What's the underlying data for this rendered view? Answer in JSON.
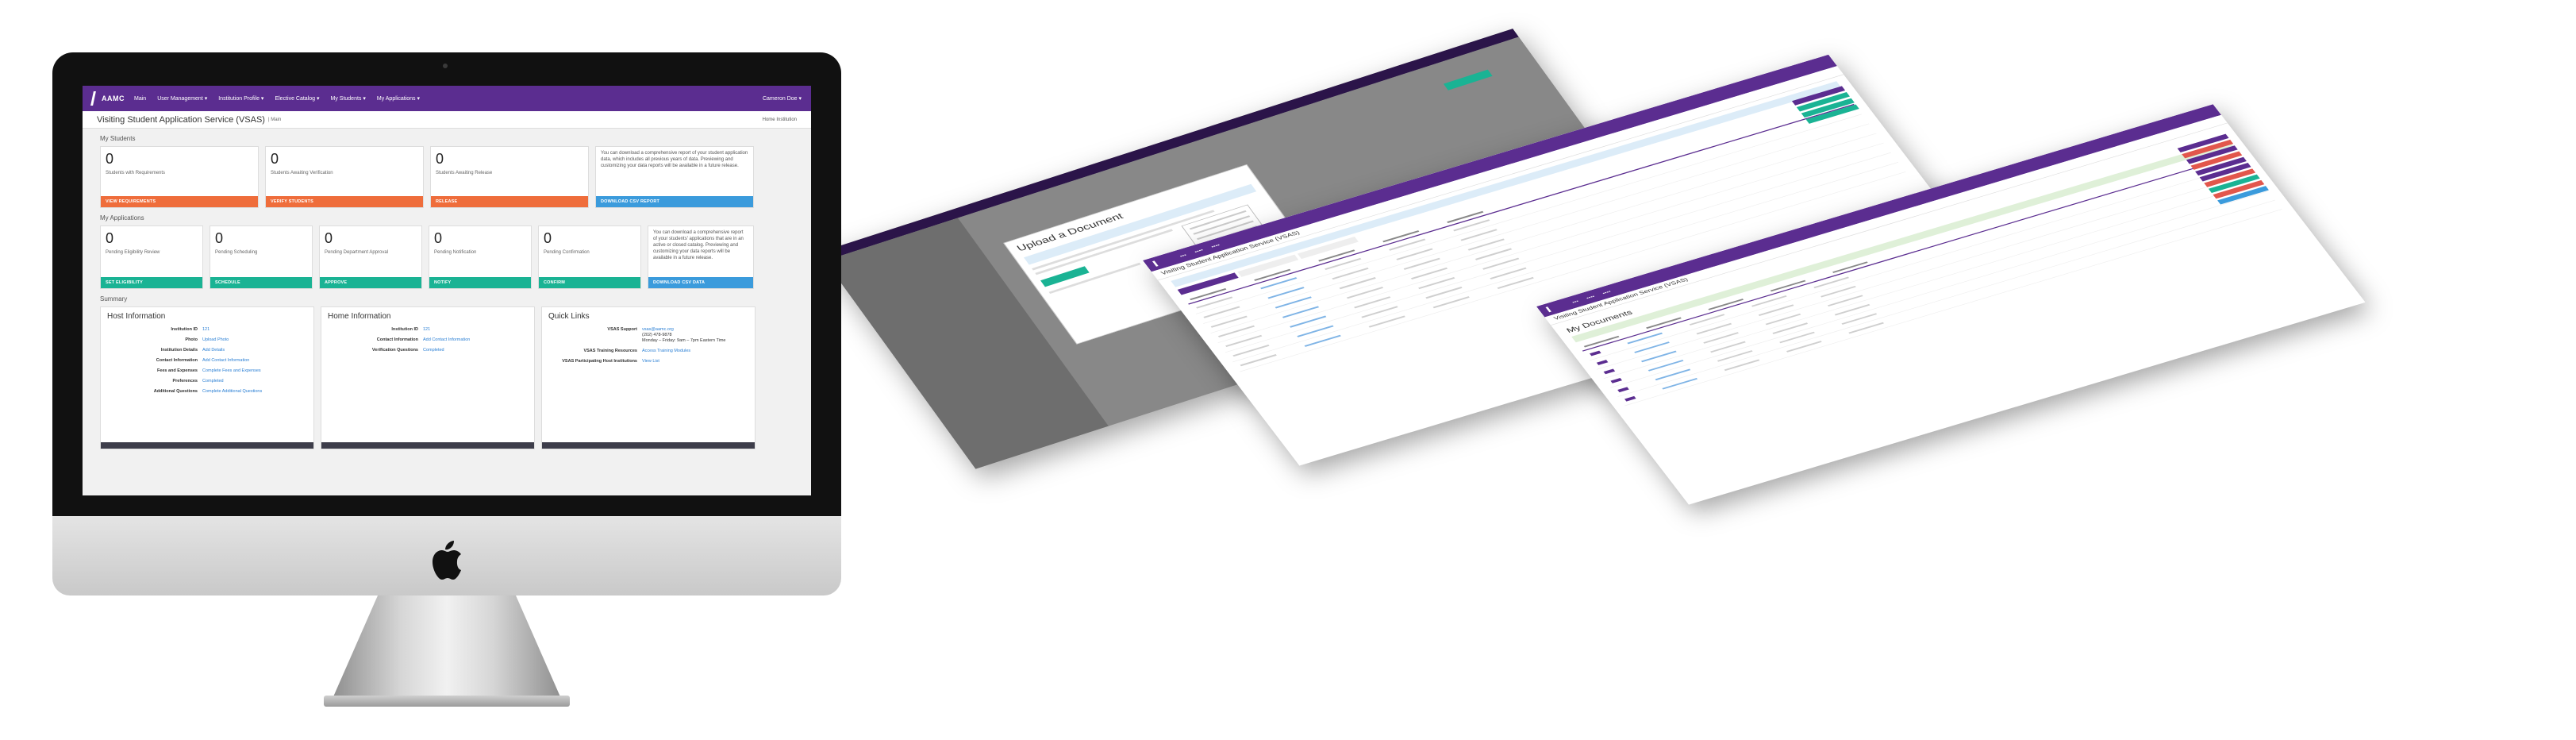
{
  "nav": {
    "logo_text": "AAMC",
    "items": [
      "Main",
      "User Management ▾",
      "Institution Profile ▾",
      "Elective Catalog ▾",
      "My Students ▾",
      "My Applications ▾"
    ],
    "user": "Cameron Doe ▾"
  },
  "header": {
    "title": "Visiting Student Application Service (VSAS)",
    "breadcrumb": "| Main",
    "home_institution": "Home Institution"
  },
  "my_students": {
    "section_title": "My Students",
    "cards": [
      {
        "count": "0",
        "label": "Students with Requirements",
        "button": "VIEW REQUIREMENTS",
        "color": "#ef6d3b"
      },
      {
        "count": "0",
        "label": "Students Awaiting Verification",
        "button": "VERIFY STUDENTS",
        "color": "#ef6d3b"
      },
      {
        "count": "0",
        "label": "Students Awaiting Release",
        "button": "RELEASE",
        "color": "#ef6d3b"
      }
    ],
    "report_card": {
      "note": "You can download a comprehensive report of your student application data, which includes all previous years of data. Previewing and customizing your data reports will be available in a future release.",
      "button": "DOWNLOAD CSV REPORT",
      "color": "#3b9bdc"
    }
  },
  "my_applications": {
    "section_title": "My Applications",
    "cards": [
      {
        "count": "0",
        "label": "Pending Eligibility Review",
        "button": "SET ELIGIBILITY",
        "color": "#1ab394"
      },
      {
        "count": "0",
        "label": "Pending Scheduling",
        "button": "SCHEDULE",
        "color": "#1ab394"
      },
      {
        "count": "0",
        "label": "Pending Department Approval",
        "button": "APPROVE",
        "color": "#1ab394"
      },
      {
        "count": "0",
        "label": "Pending Notification",
        "button": "NOTIFY",
        "color": "#1ab394"
      },
      {
        "count": "0",
        "label": "Pending Confirmation",
        "button": "CONFIRM",
        "color": "#1ab394"
      }
    ],
    "report_card": {
      "note": "You can download a comprehensive report of your students' applications that are in an active or closed catalog. Previewing and customizing your data reports will be available in a future release.",
      "button": "DOWNLOAD CSV DATA",
      "color": "#3b9bdc"
    }
  },
  "summary": {
    "section_title": "Summary",
    "host": {
      "title": "Host Information",
      "rows": [
        {
          "k": "Institution ID",
          "v": "121"
        },
        {
          "k": "Photo",
          "v": "Upload Photo"
        },
        {
          "k": "Institution Details",
          "v": "Add Details"
        },
        {
          "k": "Contact Information",
          "v": "Add Contact Information"
        },
        {
          "k": "Fees and Expenses",
          "v": "Complete Fees and Expenses"
        },
        {
          "k": "Preferences",
          "v": "Completed"
        },
        {
          "k": "Additional Questions",
          "v": "Complete Additional Questions"
        }
      ]
    },
    "home": {
      "title": "Home Information",
      "rows": [
        {
          "k": "Institution ID",
          "v": "121"
        },
        {
          "k": "Contact Information",
          "v": "Add Contact Information"
        },
        {
          "k": "Verification Questions",
          "v": "Completed"
        }
      ]
    },
    "quick_links": {
      "title": "Quick Links",
      "rows": [
        {
          "k": "VSAS Support",
          "v": "vsas@aamc.org",
          "v2": "(202) 478-9878",
          "v3": "Monday – Friday: 9am – 7pm Eastern Time"
        },
        {
          "k": "VSAS Training Resources",
          "v": "Access Training Modules"
        },
        {
          "k": "VSAS Participating Host Institutions",
          "v": "View List"
        }
      ]
    }
  },
  "modal": {
    "title": "Upload a Document"
  },
  "page2": {
    "title": "Visiting Student Application Service (VSAS)"
  },
  "page3": {
    "title": "Visiting Student Application Service (VSAS)",
    "heading": "My Documents"
  }
}
